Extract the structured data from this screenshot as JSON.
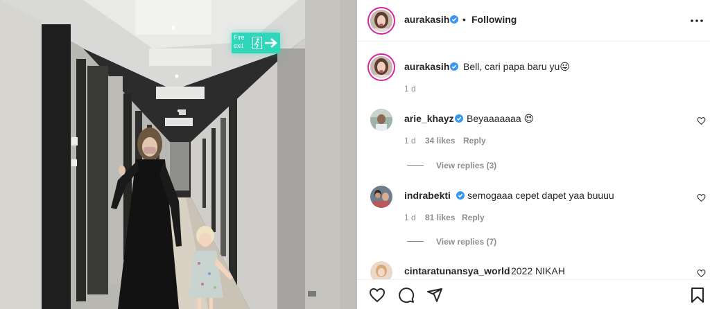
{
  "post": {
    "author": "aurakasih",
    "follow_status": "Following",
    "dot": "•",
    "more_icon": "more-horizontal-icon"
  },
  "caption": {
    "user": "aurakasih",
    "text": "Bell, cari papa baru yu😛",
    "time": "1 d"
  },
  "comments": [
    {
      "user": "arie_khayz",
      "text": "Beyaaaaaaa 😍",
      "time": "1 d",
      "likes": "34 likes",
      "reply": "Reply",
      "view_replies": "View replies (3)"
    },
    {
      "user": "indrabekti",
      "text": "semogaaa cepet dapet yaa buuuu",
      "time": "1 d",
      "likes": "81 likes",
      "reply": "Reply",
      "view_replies": "View replies (7)"
    },
    {
      "user": "cintaratunansya_world",
      "text": "2022 NIKAH"
    }
  ],
  "photo": {
    "sign_line1": "Fire",
    "sign_line2": "exit"
  },
  "colors": {
    "verified_blue": "#3897f0",
    "story_ring": "#d6249f",
    "sign_green": "#2fd6b9"
  },
  "actions": [
    "heart-icon",
    "comment-icon",
    "share-icon",
    "bookmark-icon"
  ]
}
